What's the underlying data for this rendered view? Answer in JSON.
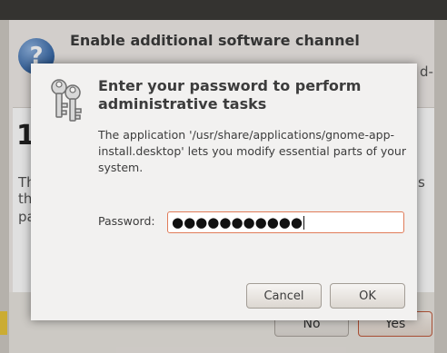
{
  "background_window": {
    "heading": "Enable additional software channel",
    "fragments": {
      "right_top": "d-",
      "left_big": "1",
      "left_line1": "Th",
      "left_line2": "th",
      "left_line3": "pa",
      "right_line1": "s"
    },
    "buttons": {
      "no": "No",
      "yes": "Yes"
    },
    "icon": "question-icon"
  },
  "dialog": {
    "icon": "keys-icon",
    "title": "Enter your password to perform administrative tasks",
    "description": "The application '/usr/share/applications/gnome-app-install.desktop' lets you modify essential parts of your system.",
    "password_label": "Password:",
    "password_value": "●●●●●●●●●●●",
    "buttons": {
      "cancel": "Cancel",
      "ok": "OK"
    }
  }
}
